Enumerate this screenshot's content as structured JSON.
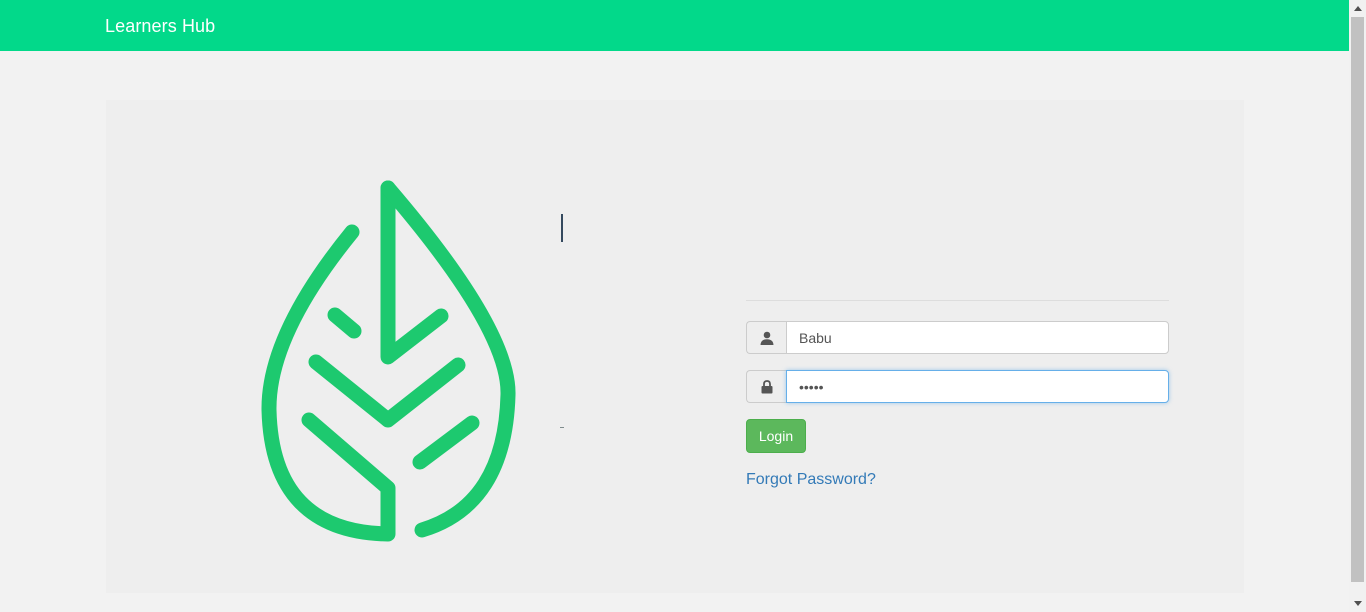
{
  "app": {
    "brand": "Learners Hub"
  },
  "login": {
    "username_value": "Babu",
    "password_value": "•••••",
    "login_label": "Login",
    "forgot_label": "Forgot Password?"
  },
  "icons": {
    "logo": "leaf-logo-icon",
    "user": "user-icon",
    "password": "lock-icon"
  },
  "colors": {
    "navbar": "#02d98a",
    "logo": "#1dc96f",
    "login_button": "#5cb85c",
    "link": "#337ab7"
  }
}
